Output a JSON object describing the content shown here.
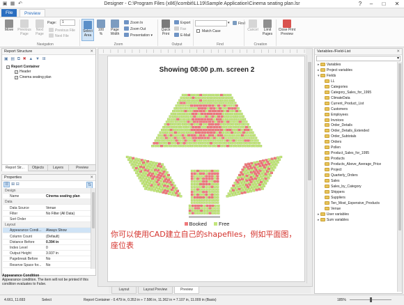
{
  "window": {
    "title": "Designer - C:\\Program Files (x86)\\combit\\LL19\\Sample Application\\Cinema seating plan.lsr",
    "help_label": "?"
  },
  "tabs": [
    {
      "label": "File"
    },
    {
      "label": "Preview"
    }
  ],
  "ribbon": {
    "navigation": {
      "group_label": "Navigation",
      "move": "Move",
      "previous_page": "Previous Page",
      "next_page": "Next Page",
      "page_label": "Page:",
      "page_value": "1",
      "previous_file": "Previous File",
      "next_file": "Next File"
    },
    "zoom": {
      "group_label": "Zoom",
      "select_area": "Select Area",
      "percent": "100 %",
      "page_width": "Page Width",
      "zoom_in": "Zoom In",
      "zoom_out": "Zoom Out",
      "presentation": "Presentation"
    },
    "output": {
      "group_label": "Output",
      "quick_print": "Quick Print",
      "export": "Export",
      "fax": "Fax",
      "email": "E-Mail"
    },
    "find": {
      "group_label": "Find",
      "find_label": "Find",
      "match_case": "Match Case",
      "search_value": ""
    },
    "creation": {
      "group_label": "Creation",
      "cancel": "Cancel",
      "limit_pages": "Limit Pages"
    },
    "close": {
      "label": "Close Print Preview"
    }
  },
  "report_structure": {
    "title": "Report Structure",
    "items": [
      {
        "label": "Report Container"
      },
      {
        "label": "Header"
      },
      {
        "label": "Cinema seating plan"
      }
    ],
    "tabs": [
      {
        "label": "Report Str..."
      },
      {
        "label": "Objects"
      },
      {
        "label": "Layers"
      },
      {
        "label": "Preview"
      }
    ]
  },
  "properties": {
    "title": "Properties",
    "rows": [
      {
        "key": "Design",
        "value": "",
        "cat": true
      },
      {
        "key": "Name",
        "value": "Cinema seating plan",
        "bold": true
      },
      {
        "key": "Data",
        "value": "",
        "cat": true
      },
      {
        "key": "Data Source",
        "value": "Venue"
      },
      {
        "key": "Filter",
        "value": "No Filter (All Data)"
      },
      {
        "key": "Sort Order",
        "value": ""
      },
      {
        "key": "Layout",
        "value": "",
        "cat": true
      },
      {
        "key": "Appearance Condi...",
        "value": "Always Show",
        "sel": true
      },
      {
        "key": "Column Count",
        "value": "(Default)"
      },
      {
        "key": "Distance Before",
        "value": "0.394 in",
        "bold": true
      },
      {
        "key": "Index Level",
        "value": "0"
      },
      {
        "key": "Output Height",
        "value": "3.937 in"
      },
      {
        "key": "Pagebreak Before",
        "value": "No"
      },
      {
        "key": "Reserve Space for...",
        "value": "No"
      }
    ],
    "desc_title": "Appearance Condition",
    "desc_text": "Appearance condition. The item will not be printed if this condition evaluates to False."
  },
  "preview": {
    "page_title": "Showing 08:00 p.m. screen 2",
    "legend": [
      {
        "label": "Booked"
      },
      {
        "label": "Free"
      }
    ],
    "overlay_text": "你可以使用CAD建立自己的shapefiles，例如平面图，座位表",
    "bottom_tabs": [
      {
        "label": "Layout"
      },
      {
        "label": "Layout Preview"
      },
      {
        "label": "Preview"
      }
    ]
  },
  "fields": {
    "title": "Variables-/Field-List",
    "items": [
      {
        "label": "Variables",
        "depth": 0
      },
      {
        "label": "Project variables",
        "depth": 0
      },
      {
        "label": "Fields",
        "depth": 0
      },
      {
        "label": "LL",
        "depth": 1
      },
      {
        "label": "Categories",
        "depth": 1
      },
      {
        "label": "Category_Sales_for_1995",
        "depth": 1
      },
      {
        "label": "ClimateData",
        "depth": 1
      },
      {
        "label": "Current_Product_List",
        "depth": 1
      },
      {
        "label": "Customers",
        "depth": 1
      },
      {
        "label": "Employees",
        "depth": 1
      },
      {
        "label": "Invoices",
        "depth": 1
      },
      {
        "label": "Order_Details",
        "depth": 1
      },
      {
        "label": "Order_Details_Extended",
        "depth": 1
      },
      {
        "label": "Order_Subtotals",
        "depth": 1
      },
      {
        "label": "Orders",
        "depth": 1
      },
      {
        "label": "Pollen",
        "depth": 1
      },
      {
        "label": "Product_Sales_for_1995",
        "depth": 1
      },
      {
        "label": "Products",
        "depth": 1
      },
      {
        "label": "Products_Above_Average_Price",
        "depth": 1
      },
      {
        "label": "Project",
        "depth": 1
      },
      {
        "label": "Quarterly_Orders",
        "depth": 1
      },
      {
        "label": "Sales",
        "depth": 1
      },
      {
        "label": "Sales_by_Category",
        "depth": 1
      },
      {
        "label": "Shippers",
        "depth": 1
      },
      {
        "label": "Suppliers",
        "depth": 1
      },
      {
        "label": "Ten_Most_Expensive_Products",
        "depth": 1
      },
      {
        "label": "Venue",
        "depth": 1
      },
      {
        "label": "User variables",
        "depth": 0
      },
      {
        "label": "Sum variables",
        "depth": 0
      }
    ]
  },
  "status": {
    "coords": "4.661, 11.693",
    "mode": "Select",
    "object_info": "Report Container - 0.479 in, 0.353 in ÷ 7.586 in, 11.362 in = 7.107 in, 11.009 in (Basis)",
    "zoom": "185%"
  },
  "colors": {
    "booked": "#ef7a7c",
    "free": "#c3e67d",
    "accent": "#2b6fc1"
  }
}
